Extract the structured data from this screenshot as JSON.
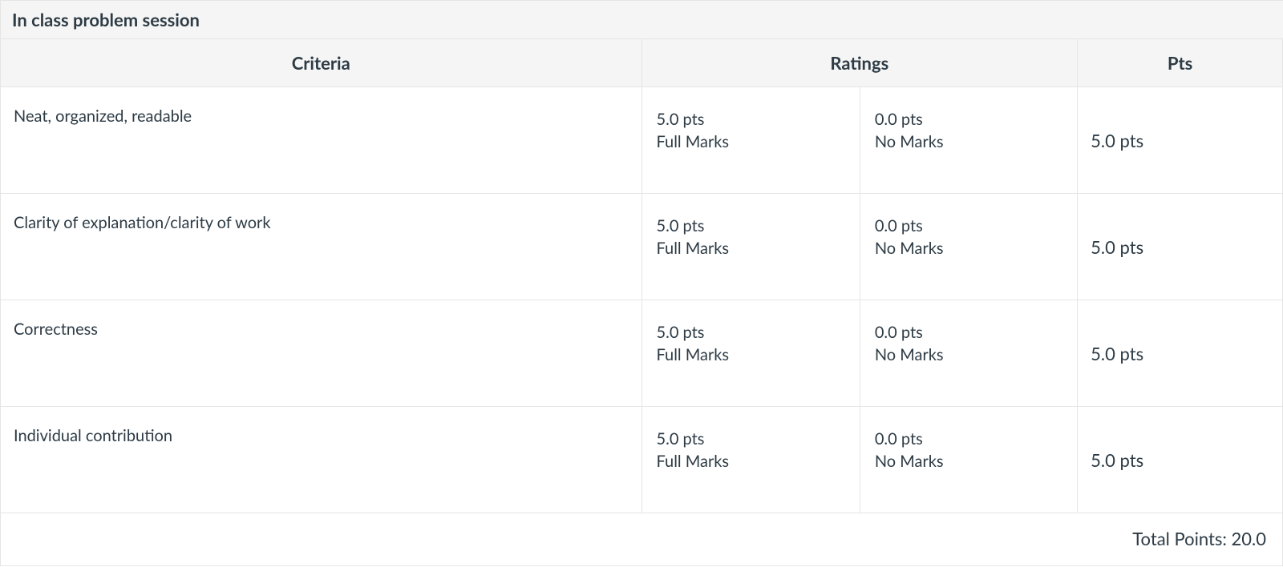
{
  "title": "In class problem session",
  "headers": {
    "criteria": "Criteria",
    "ratings": "Ratings",
    "pts": "Pts"
  },
  "rows": [
    {
      "criterion": "Neat, organized, readable",
      "ratings": [
        {
          "pts": "5.0 pts",
          "label": "Full Marks"
        },
        {
          "pts": "0.0 pts",
          "label": "No Marks"
        }
      ],
      "pts": "5.0 pts"
    },
    {
      "criterion": "Clarity of explanation/clarity of work",
      "ratings": [
        {
          "pts": "5.0 pts",
          "label": "Full Marks"
        },
        {
          "pts": "0.0 pts",
          "label": "No Marks"
        }
      ],
      "pts": "5.0 pts"
    },
    {
      "criterion": "Correctness",
      "ratings": [
        {
          "pts": "5.0 pts",
          "label": "Full Marks"
        },
        {
          "pts": "0.0 pts",
          "label": "No Marks"
        }
      ],
      "pts": "5.0 pts"
    },
    {
      "criterion": "Individual contribution",
      "ratings": [
        {
          "pts": "5.0 pts",
          "label": "Full Marks"
        },
        {
          "pts": "0.0 pts",
          "label": "No Marks"
        }
      ],
      "pts": "5.0 pts"
    }
  ],
  "total": "Total Points: 20.0"
}
